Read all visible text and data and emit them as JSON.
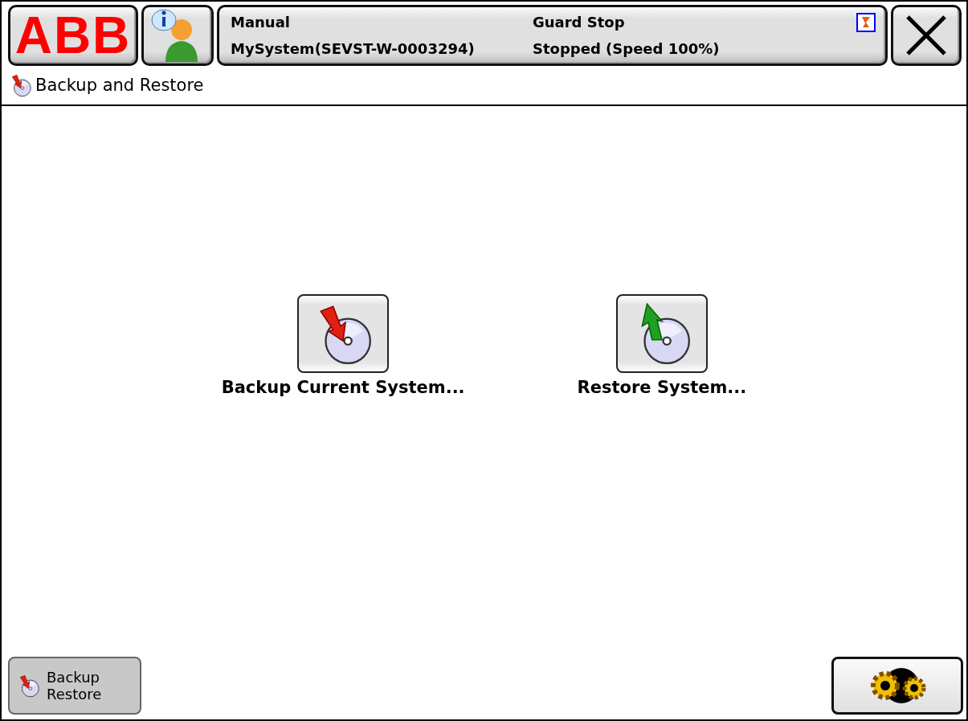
{
  "header": {
    "logo": "ABB",
    "status": {
      "mode": "Manual",
      "system": "MySystem(SEVST-W-0003294)",
      "state": "Guard Stop",
      "motion": "Stopped (Speed 100%)"
    }
  },
  "title": "Backup and Restore",
  "actions": [
    {
      "kind": "backup",
      "label": "Backup Current System..."
    },
    {
      "kind": "restore",
      "label": "Restore System..."
    }
  ],
  "taskbar": [
    {
      "label": "Backup\nRestore",
      "selected": true
    }
  ]
}
